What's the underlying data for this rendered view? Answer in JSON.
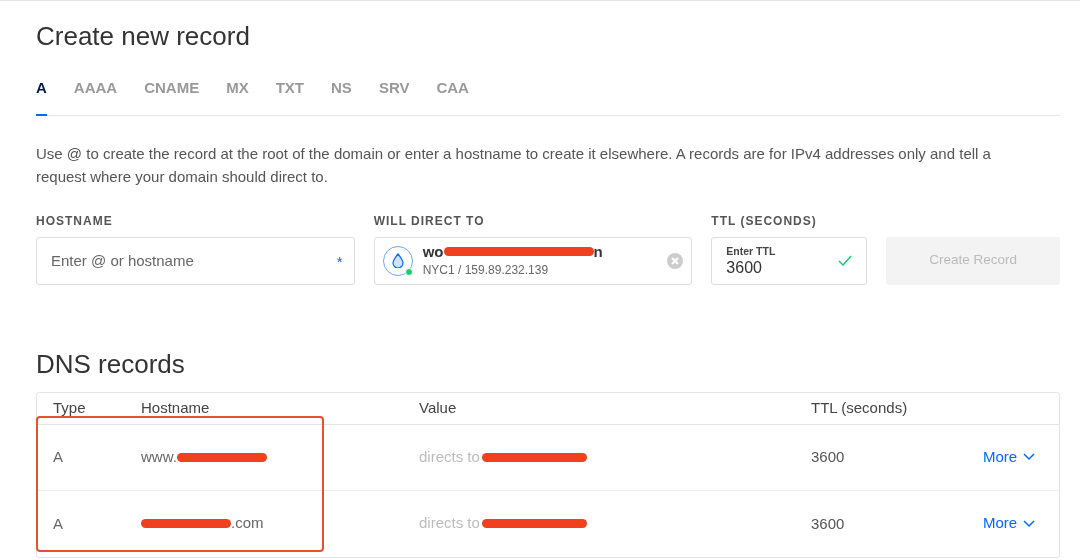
{
  "title": "Create new record",
  "tabs": [
    {
      "label": "A",
      "selected": true
    },
    {
      "label": "AAAA",
      "selected": false
    },
    {
      "label": "CNAME",
      "selected": false
    },
    {
      "label": "MX",
      "selected": false
    },
    {
      "label": "TXT",
      "selected": false
    },
    {
      "label": "NS",
      "selected": false
    },
    {
      "label": "SRV",
      "selected": false
    },
    {
      "label": "CAA",
      "selected": false
    }
  ],
  "description": "Use @ to create the record at the root of the domain or enter a hostname to create it elsewhere. A records are for IPv4 addresses only and tell a request where your domain should direct to.",
  "form": {
    "hostname": {
      "label": "HOSTNAME",
      "placeholder": "Enter @ or hostname",
      "required_mark": "*"
    },
    "direct_to": {
      "label": "WILL DIRECT TO",
      "name": {
        "before": "wo",
        "after": "n"
      },
      "detail": "NYC1 / 159.89.232.139",
      "online": true
    },
    "ttl": {
      "label": "TTL (SECONDS)",
      "floating_label": "Enter TTL",
      "value": "3600",
      "valid": true
    },
    "submit": {
      "label": "Create Record",
      "disabled": true
    }
  },
  "records_title": "DNS records",
  "table": {
    "columns": [
      "Type",
      "Hostname",
      "Value",
      "TTL (seconds)"
    ],
    "rows": [
      {
        "type": "A",
        "hostname": {
          "before": "www."
        },
        "value": {
          "before": "directs to"
        },
        "ttl": "3600",
        "action": "More"
      },
      {
        "type": "A",
        "hostname": {
          "after": ".com"
        },
        "value": {
          "before": "directs to"
        },
        "ttl": "3600",
        "action": "More"
      }
    ]
  },
  "highlight": {
    "color": "#e8502f"
  }
}
